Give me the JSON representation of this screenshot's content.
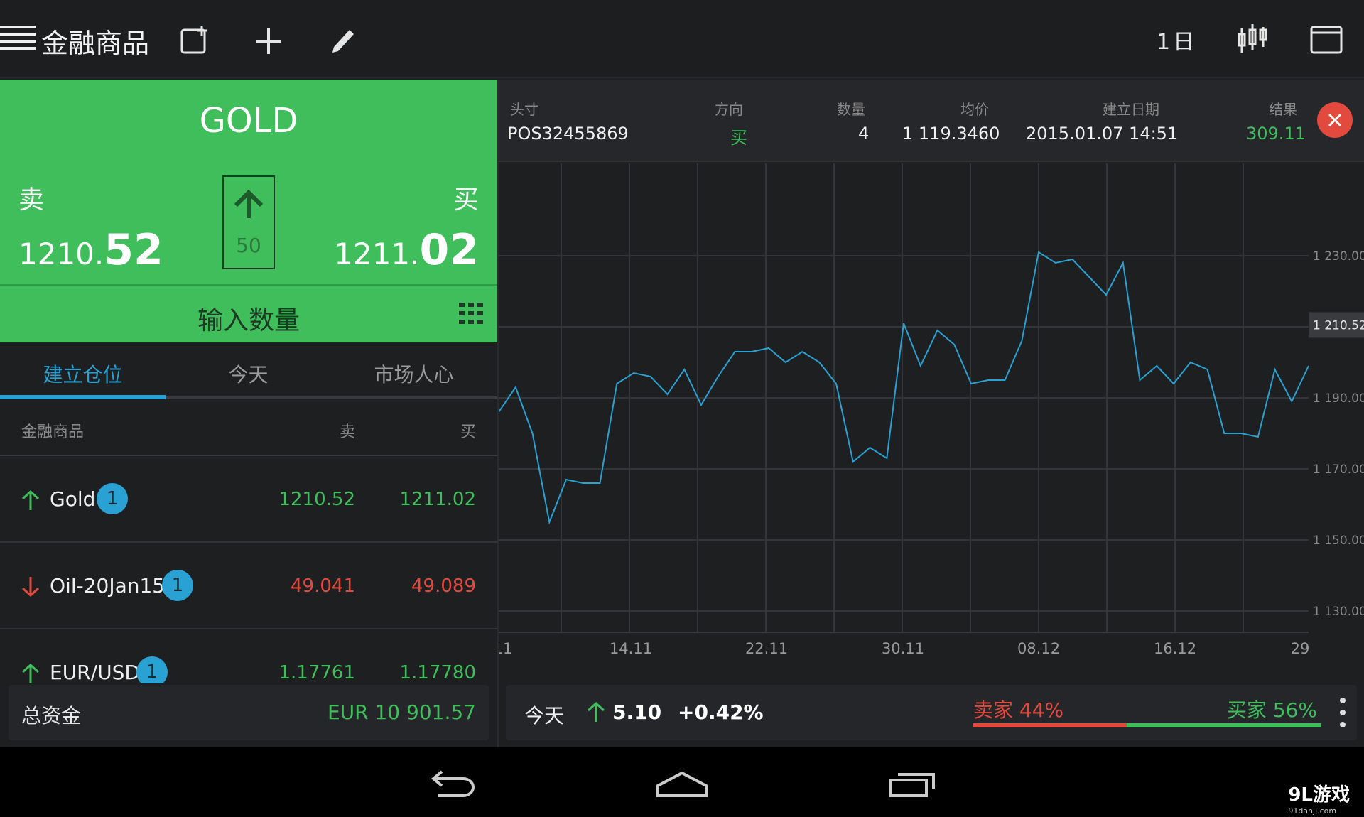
{
  "app": {
    "title": "金融商品",
    "period": "1日"
  },
  "quote": {
    "instrument": "GOLD",
    "sell_label": "卖",
    "buy_label": "买",
    "sell_main": "1210.",
    "sell_big": "52",
    "buy_main": "1211.",
    "buy_big": "02",
    "spread": "50",
    "qty_label": "输入数量"
  },
  "tabs": [
    "建立仓位",
    "今天",
    "市场人心"
  ],
  "list": {
    "headers": {
      "name": "金融商品",
      "sell": "卖",
      "buy": "买"
    },
    "rows": [
      {
        "name": "Gold",
        "badge": "1",
        "sell": "1210.52",
        "buy": "1211.02",
        "direction": "up"
      },
      {
        "name": "Oil-20Jan15",
        "badge": "1",
        "sell": "49.041",
        "buy": "49.089",
        "direction": "down"
      },
      {
        "name": "EUR/USD",
        "badge": "1",
        "sell": "1.17761",
        "buy": "1.17780",
        "direction": "up"
      }
    ]
  },
  "total": {
    "label": "总资金",
    "value": "EUR 10 901.57"
  },
  "position": {
    "headers": {
      "id": "头寸",
      "dir": "方向",
      "qty": "数量",
      "avg": "均价",
      "date": "建立日期",
      "result": "结果"
    },
    "values": {
      "id": "POS32455869",
      "dir": "买",
      "qty": "4",
      "avg": "1 119.3460",
      "date": "2015.01.07 14:51",
      "result": "309.11"
    }
  },
  "chart_data": {
    "type": "line",
    "x_ticks": [
      "11",
      "14.11",
      "22.11",
      "30.11",
      "08.12",
      "16.12",
      "29"
    ],
    "y_ticks": [
      "1 230.00",
      "1 190.00",
      "1 170.00",
      "1 150.00",
      "1 130.00"
    ],
    "current_label": "1 210.52",
    "ylim": [
      1124,
      1256
    ],
    "series": [
      {
        "values": [
          1186,
          1193,
          1180,
          1155,
          1167,
          1166,
          1166,
          1194,
          1197,
          1196,
          1191,
          1198,
          1188,
          1196,
          1203,
          1203,
          1204,
          1200,
          1203,
          1200,
          1194,
          1172,
          1176,
          1173,
          1211,
          1199,
          1209,
          1205,
          1194,
          1195,
          1195,
          1206,
          1231,
          1228,
          1229,
          1224,
          1219,
          1228,
          1195,
          1199,
          1194,
          1200,
          1198,
          1180,
          1180,
          1179,
          1198,
          1189,
          1199
        ],
        "color": "#2aa1d3"
      }
    ]
  },
  "summary": {
    "today_label": "今天",
    "change": "5.10",
    "pct": "+0.42%",
    "sellers": "卖家 44%",
    "buyers": "买家 56%",
    "sellers_share": 44,
    "buyers_share": 56
  },
  "watermark": {
    "brand": "9L游戏",
    "url": "91danji.com"
  },
  "colors": {
    "green": "#3fbe5b",
    "red": "#e24a3e",
    "blue": "#2aa1d3"
  }
}
